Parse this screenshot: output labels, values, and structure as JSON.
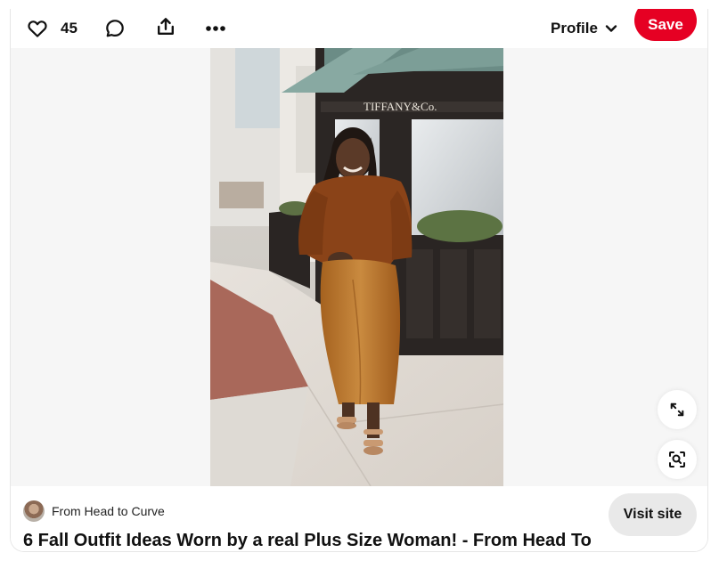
{
  "topbar": {
    "like_count": "45",
    "profile_label": "Profile",
    "save_label": "Save"
  },
  "pin": {
    "storefront_sign": "TIFFANY&Co.",
    "source_name": "From Head to Curve",
    "visit_label": "Visit site",
    "title": "6 Fall Outfit Ideas Worn by a real Plus Size Woman! - From Head To"
  },
  "icons": [
    "heart-icon",
    "comment-icon",
    "share-icon",
    "more-icon",
    "chevron-down-icon",
    "expand-icon",
    "visual-search-icon"
  ],
  "colors": {
    "save_red": "#e60023",
    "visit_gray": "#e9e9e9",
    "sweater": "#8a4318",
    "skirt": "#b8742b"
  }
}
